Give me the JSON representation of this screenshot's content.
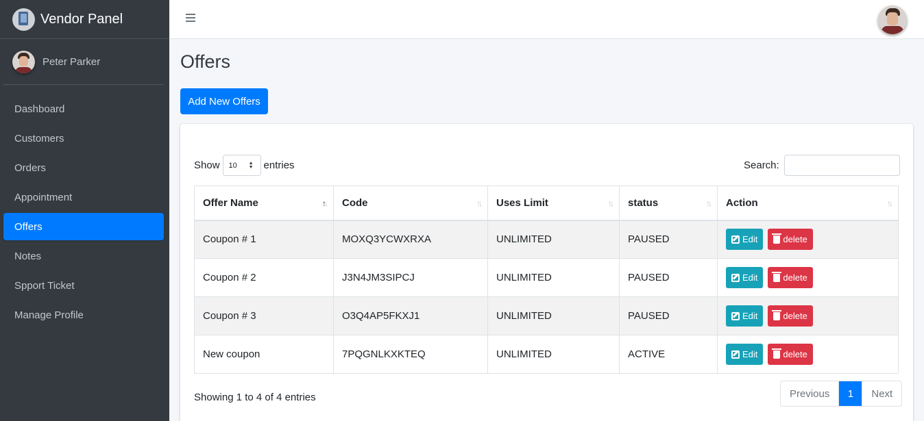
{
  "brand": {
    "title": "Vendor Panel"
  },
  "user": {
    "name": "Peter Parker"
  },
  "sidebar": {
    "items": [
      {
        "label": "Dashboard"
      },
      {
        "label": "Customers"
      },
      {
        "label": "Orders"
      },
      {
        "label": "Appointment"
      },
      {
        "label": "Offers",
        "active": true
      },
      {
        "label": "Notes"
      },
      {
        "label": "Spport Ticket"
      },
      {
        "label": "Manage Profile"
      }
    ]
  },
  "page": {
    "title": "Offers",
    "add_button": "Add New Offers"
  },
  "table_controls": {
    "show_label": "Show",
    "entries_value": "10",
    "entries_label": "entries",
    "search_label": "Search:",
    "search_value": ""
  },
  "table": {
    "columns": [
      "Offer Name",
      "Code",
      "Uses Limit",
      "status",
      "Action"
    ],
    "sorted_column": "Offer Name",
    "rows": [
      {
        "name": "Coupon # 1",
        "code": "MOXQ3YCWXRXA",
        "limit": "UNLIMITED",
        "status": "PAUSED"
      },
      {
        "name": "Coupon # 2",
        "code": "J3N4JM3SIPCJ",
        "limit": "UNLIMITED",
        "status": "PAUSED"
      },
      {
        "name": "Coupon # 3",
        "code": "O3Q4AP5FKXJ1",
        "limit": "UNLIMITED",
        "status": "PAUSED"
      },
      {
        "name": "New coupon",
        "code": "7PQGNLKXKTEQ",
        "limit": "UNLIMITED",
        "status": "ACTIVE"
      }
    ],
    "edit_label": "Edit",
    "delete_label": "delete"
  },
  "footer": {
    "info": "Showing 1 to 4 of 4 entries",
    "prev": "Previous",
    "current_page": "1",
    "next": "Next"
  },
  "colors": {
    "sidebar_bg": "#343a40",
    "primary": "#007bff",
    "edit": "#17a2b8",
    "delete": "#dc3545"
  }
}
